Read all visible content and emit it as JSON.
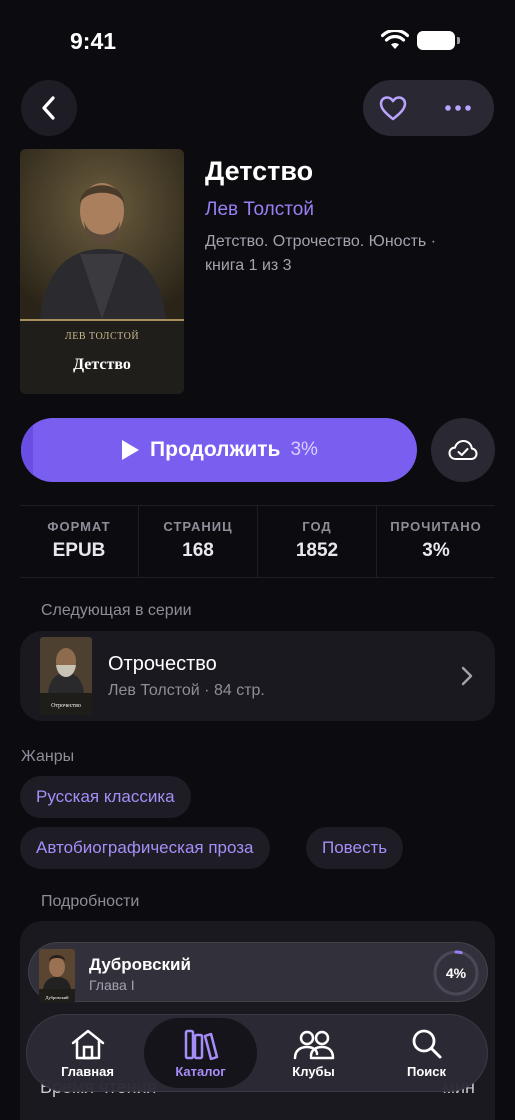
{
  "status_bar": {
    "time": "9:41"
  },
  "book": {
    "title": "Детство",
    "author": "Лев Толстой",
    "series_line1": "Детство. Отрочество. Юность ·",
    "series_line2": "книга 1 из 3",
    "cover_author": "ЛЕВ ТОЛСТОЙ",
    "cover_title": "Детство"
  },
  "continue": {
    "label": "Продолжить",
    "percent_text": "3%",
    "progress": 0.03
  },
  "stats": [
    {
      "label": "ФОРМАТ",
      "value": "EPUB"
    },
    {
      "label": "СТРАНИЦ",
      "value": "168"
    },
    {
      "label": "ГОД",
      "value": "1852"
    },
    {
      "label": "ПРОЧИТАНО",
      "value": "3%"
    }
  ],
  "next_in_series": {
    "section_label": "Следующая в серии",
    "title": "Отрочество",
    "meta": "Лев Толстой · 84 стр.",
    "thumb_title": "Отрочество"
  },
  "genres": {
    "section_label": "Жанры",
    "items": [
      "Русская классика",
      "Автобиографическая проза",
      "Повесть"
    ]
  },
  "details": {
    "section_label": "Подробности",
    "bottom_label": "Время чтения",
    "bottom_value": "мин"
  },
  "mini_player": {
    "title": "Дубровский",
    "chapter": "Глава I",
    "percent_text": "4%",
    "progress": 0.04,
    "thumb_title": "Дубровский"
  },
  "tabs": [
    {
      "label": "Главная",
      "icon": "home-icon",
      "active": false
    },
    {
      "label": "Каталог",
      "icon": "books-icon",
      "active": true
    },
    {
      "label": "Клубы",
      "icon": "people-icon",
      "active": false
    },
    {
      "label": "Поиск",
      "icon": "search-icon",
      "active": false
    }
  ],
  "colors": {
    "accent": "#7a5ef0",
    "accent_text": "#9b80f5",
    "background": "#0c0b10"
  }
}
